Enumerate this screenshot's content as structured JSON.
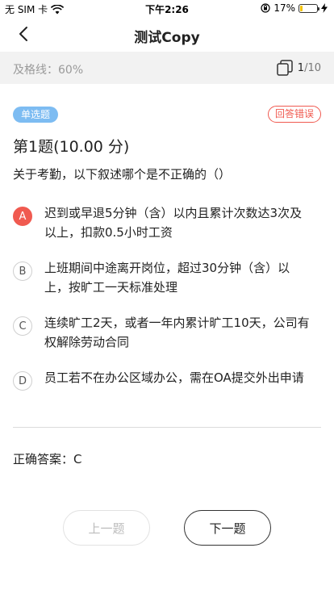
{
  "status_bar": {
    "carrier": "无 SIM 卡",
    "time": "下午2:26",
    "battery_percent": "17%",
    "battery_level": 0.17,
    "battery_color": "#f2c200"
  },
  "nav": {
    "title": "测试Copy",
    "back_icon": "chevron-left-icon"
  },
  "pass_bar": {
    "pass_line": "及格线：60%",
    "current": "1",
    "total": "/10",
    "pager_icon": "copy-icon"
  },
  "question": {
    "type_tag": "单选题",
    "result_tag": "回答错误",
    "title": "第1题(10.00 分)",
    "stem": "关于考勤，以下叙述哪个是不正确的（）",
    "options": [
      {
        "letter": "A",
        "text": "迟到或早退5分钟（含）以内且累计次数达3次及以上，扣款0.5小时工资",
        "state": "wrong"
      },
      {
        "letter": "B",
        "text": "上班期间中途离开岗位，超过30分钟（含）以上，按旷工一天标准处理",
        "state": "normal"
      },
      {
        "letter": "C",
        "text": "连续旷工2天，或者一年内累计旷工10天，公司有权解除劳动合同",
        "state": "normal"
      },
      {
        "letter": "D",
        "text": "员工若不在办公区域办公，需在OA提交外出申请",
        "state": "normal"
      }
    ],
    "correct_answer": "正确答案：C"
  },
  "buttons": {
    "prev": "上一题",
    "next": "下一题"
  },
  "colors": {
    "accent_blue": "#7dbcf2",
    "error_red": "#f05a50"
  }
}
